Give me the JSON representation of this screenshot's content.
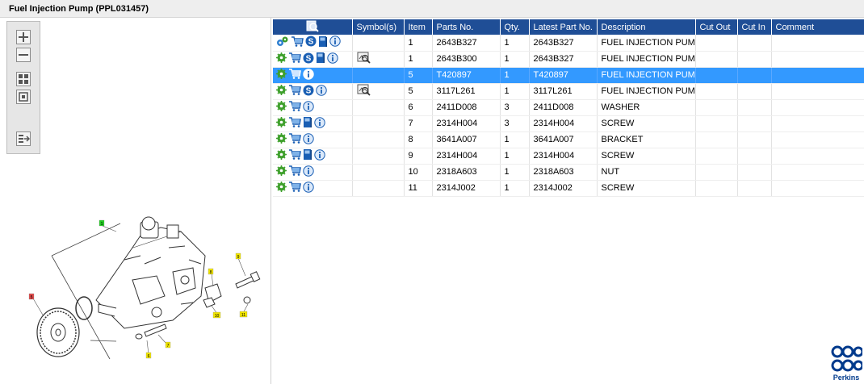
{
  "window": {
    "title": "Fuel Injection Pump (PPL031457)"
  },
  "columns": [
    "",
    "Symbol(s)",
    "Item",
    "Parts No.",
    "Qty.",
    "Latest Part No.",
    "Description",
    "Cut Out",
    "Cut In",
    "Comment"
  ],
  "rows": [
    {
      "item": "1",
      "parts_no": "2643B327",
      "qty": "1",
      "latest": "2643B327",
      "desc": "FUEL INJECTION PUMP",
      "icons": [
        "gears-icon",
        "cart-icon",
        "service-s-icon",
        "book-icon",
        "info-icon"
      ],
      "symbol": ""
    },
    {
      "item": "1",
      "parts_no": "2643B300",
      "qty": "1",
      "latest": "2643B327",
      "desc": "FUEL INJECTION PUMP",
      "icons": [
        "gear-icon",
        "cart-icon",
        "service-s-icon",
        "book-icon",
        "info-icon"
      ],
      "symbol": "view-icon"
    },
    {
      "item": "5",
      "parts_no": "T420897",
      "qty": "1",
      "latest": "T420897",
      "desc": "FUEL INJECTION PUMP G",
      "icons": [
        "gear-icon",
        "cart-icon",
        "info-icon"
      ],
      "symbol": "",
      "selected": true
    },
    {
      "item": "5",
      "parts_no": "3117L261",
      "qty": "1",
      "latest": "3117L261",
      "desc": "FUEL INJECTION PUMP G",
      "icons": [
        "gear-icon",
        "cart-icon",
        "service-s-icon",
        "info-icon"
      ],
      "symbol": "view-icon"
    },
    {
      "item": "6",
      "parts_no": "2411D008",
      "qty": "3",
      "latest": "2411D008",
      "desc": "WASHER",
      "icons": [
        "gear-icon",
        "cart-icon",
        "info-icon"
      ],
      "symbol": ""
    },
    {
      "item": "7",
      "parts_no": "2314H004",
      "qty": "3",
      "latest": "2314H004",
      "desc": "SCREW",
      "icons": [
        "gear-icon",
        "cart-icon",
        "book-icon",
        "info-icon"
      ],
      "symbol": ""
    },
    {
      "item": "8",
      "parts_no": "3641A007",
      "qty": "1",
      "latest": "3641A007",
      "desc": "BRACKET",
      "icons": [
        "gear-icon",
        "cart-icon",
        "info-icon"
      ],
      "symbol": ""
    },
    {
      "item": "9",
      "parts_no": "2314H004",
      "qty": "1",
      "latest": "2314H004",
      "desc": "SCREW",
      "icons": [
        "gear-icon",
        "cart-icon",
        "book-icon",
        "info-icon"
      ],
      "symbol": ""
    },
    {
      "item": "10",
      "parts_no": "2318A603",
      "qty": "1",
      "latest": "2318A603",
      "desc": "NUT",
      "icons": [
        "gear-icon",
        "cart-icon",
        "info-icon"
      ],
      "symbol": ""
    },
    {
      "item": "11",
      "parts_no": "2314J002",
      "qty": "1",
      "latest": "2314J002",
      "desc": "SCREW",
      "icons": [
        "gear-icon",
        "cart-icon",
        "info-icon"
      ],
      "symbol": ""
    }
  ],
  "diagram": {
    "callouts": [
      {
        "label": "1",
        "color": "#22cc22"
      },
      {
        "label": "5",
        "color": "#e04848"
      },
      {
        "label": "6",
        "color": "#f2e600"
      },
      {
        "label": "7",
        "color": "#f2e600"
      },
      {
        "label": "8",
        "color": "#f2e600"
      },
      {
        "label": "9",
        "color": "#f2e600"
      },
      {
        "label": "10",
        "color": "#f2e600"
      },
      {
        "label": "11",
        "color": "#f2e600"
      }
    ]
  },
  "tools": [
    "zoom-in-icon",
    "zoom-out-icon",
    "fit-all-icon",
    "fit-window-icon",
    "export-icon"
  ],
  "brand": {
    "name": "Perkins",
    "color": "#003a8c"
  },
  "colors": {
    "header": "#1f4e96",
    "selected": "#3399ff"
  }
}
